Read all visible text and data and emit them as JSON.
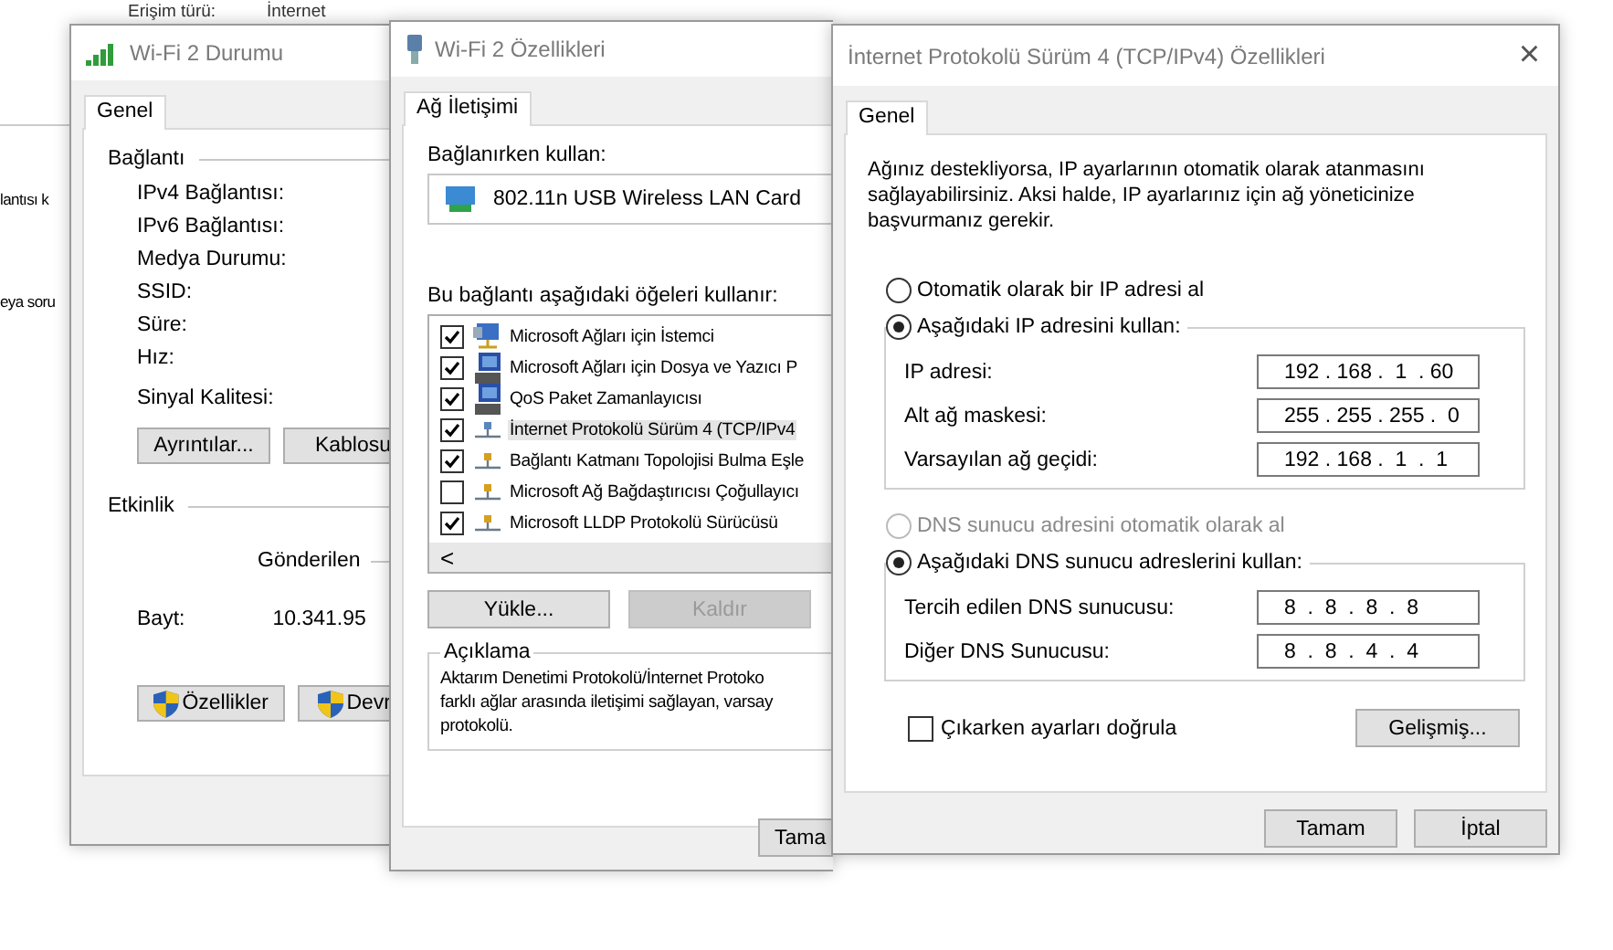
{
  "background": {
    "top_labels": [
      "Erişim türü:",
      "İnternet"
    ],
    "side_texts": [
      "lantısı k",
      "eya soru"
    ]
  },
  "status_window": {
    "title": "Wi-Fi 2 Durumu",
    "tabs": [
      {
        "label": "Genel",
        "selected": true
      }
    ],
    "connection_heading": "Bağlantı",
    "connection_rows": [
      "IPv4 Bağlantısı:",
      "IPv6 Bağlantısı:",
      "Medya Durumu:",
      "SSID:",
      "Süre:",
      "Hız:"
    ],
    "signal_label": "Sinyal Kalitesi:",
    "detail_buttons": [
      "Ayrıntılar...",
      "Kablosu"
    ],
    "activity_heading": "Etkinlik",
    "sent_label": "Gönderilen",
    "bytes_label": "Bayt:",
    "bytes_sent": "10.341.95",
    "bottom_buttons": [
      {
        "label": "Özellikler",
        "shield": true
      },
      {
        "label": "Devr",
        "shield": true
      }
    ]
  },
  "properties_window": {
    "title": "Wi-Fi 2 Özellikleri",
    "tabs": [
      {
        "label": "Ağ İletişimi",
        "selected": true
      }
    ],
    "connect_using_label": "Bağlanırken kullan:",
    "adapter": "802.11n USB Wireless LAN Card",
    "items_label": "Bu bağlantı aşağıdaki öğeleri kullanır:",
    "items": [
      {
        "label": "Microsoft Ağları için İstemci",
        "kind": "client",
        "checked": true,
        "selected": false
      },
      {
        "label": "Microsoft Ağları için Dosya ve Yazıcı P",
        "kind": "service",
        "checked": true,
        "selected": false
      },
      {
        "label": "QoS Paket Zamanlayıcısı",
        "kind": "service",
        "checked": true,
        "selected": false
      },
      {
        "label": "İnternet Protokolü Sürüm 4 (TCP/IPv4",
        "kind": "protocol",
        "checked": true,
        "selected": true
      },
      {
        "label": "Bağlantı Katmanı Topolojisi Bulma Eşle",
        "kind": "protocol",
        "checked": true,
        "selected": false
      },
      {
        "label": "Microsoft Ağ Bağdaştırıcısı Çoğullayıcı",
        "kind": "protocol",
        "checked": false,
        "selected": false
      },
      {
        "label": "Microsoft LLDP Protokolü Sürücüsü",
        "kind": "protocol",
        "checked": true,
        "selected": false
      }
    ],
    "scroll_left": "<",
    "buttons": [
      {
        "label": "Yükle...",
        "disabled": false
      },
      {
        "label": "Kaldır",
        "disabled": true
      }
    ],
    "description_title": "Açıklama",
    "description_lines": [
      "Aktarım Denetimi Protokolü/İnternet Protoko",
      "farklı ağlar arasında iletişimi sağlayan, varsay",
      "protokolü."
    ],
    "ok_button": "Tama"
  },
  "ipv4_window": {
    "title": "İnternet Protokolü Sürüm 4 (TCP/IPv4) Özellikleri",
    "close": "×",
    "tabs": [
      {
        "label": "Genel",
        "selected": true
      }
    ],
    "intro": "Ağınız destekliyorsa, IP ayarlarının otomatik olarak atanmasını sağlayabilirsiniz. Aksi halde, IP ayarlarınız için ağ yöneticinize başvurmanız gerekir.",
    "ip_options": [
      {
        "label": "Otomatik olarak bir IP adresi al",
        "selected": false,
        "disabled": false
      },
      {
        "label": "Aşağıdaki IP adresini kullan:",
        "selected": true,
        "disabled": false
      }
    ],
    "ip_fields": [
      {
        "label": "IP adresi:",
        "value": "192 . 168 .  1  . 60"
      },
      {
        "label": "Alt ağ maskesi:",
        "value": "255 . 255 . 255 .  0"
      },
      {
        "label": "Varsayılan ağ geçidi:",
        "value": "192 . 168 .  1  .  1"
      }
    ],
    "dns_options": [
      {
        "label": "DNS sunucu adresini otomatik olarak al",
        "selected": false,
        "disabled": true
      },
      {
        "label": "Aşağıdaki DNS sunucu adreslerini kullan:",
        "selected": true,
        "disabled": false
      }
    ],
    "dns_fields": [
      {
        "label": "Tercih edilen DNS sunucusu:",
        "value": "8  .  8  .  8  .  8"
      },
      {
        "label": "Diğer DNS Sunucusu:",
        "value": "8  .  8  .  4  .  4"
      }
    ],
    "validate": {
      "label": "Çıkarken ayarları doğrula",
      "checked": false
    },
    "advanced_button": "Gelişmiş...",
    "buttons": [
      "Tamam",
      "İptal"
    ]
  }
}
